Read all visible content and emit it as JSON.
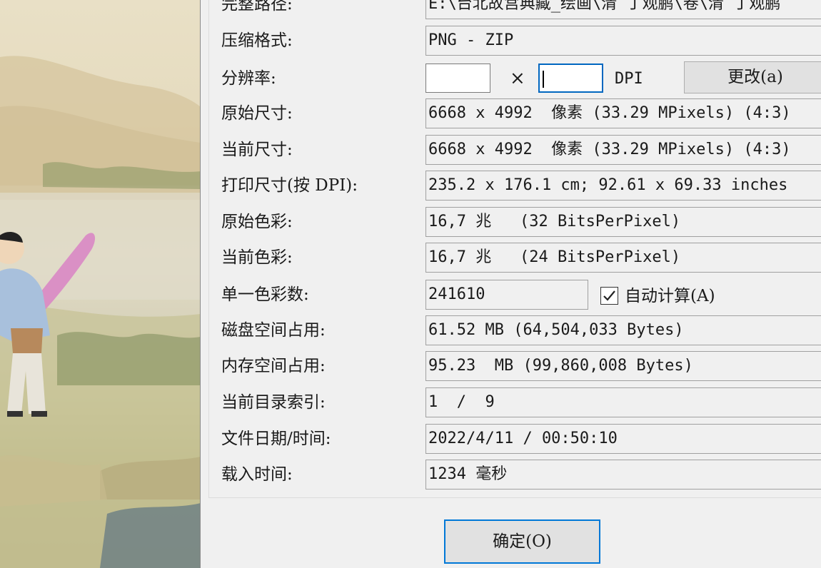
{
  "rows": {
    "full_path": {
      "label": "完整路径:",
      "value": "E:\\台北故宫典藏_绘画\\清 丁观鹏\\卷\\清 丁观鹏"
    },
    "compression": {
      "label": "压缩格式:",
      "value": "PNG - ZIP"
    },
    "resolution": {
      "label": "分辨率:",
      "times": "×",
      "unit": "DPI",
      "x_value": "",
      "y_value": "",
      "change_button": "更改(a)"
    },
    "original_size": {
      "label": "原始尺寸:",
      "value": "6668 x 4992  像素 (33.29 MPixels) (4:3)"
    },
    "current_size": {
      "label": "当前尺寸:",
      "value": "6668 x 4992  像素 (33.29 MPixels) (4:3)"
    },
    "print_size": {
      "label": "打印尺寸(按 DPI):",
      "value": "235.2 x 176.1 cm; 92.61 x 69.33 inches"
    },
    "original_colors": {
      "label": "原始色彩:",
      "value": "16,7 兆   (32 BitsPerPixel)"
    },
    "current_colors": {
      "label": "当前色彩:",
      "value": "16,7 兆   (24 BitsPerPixel)"
    },
    "unique_colors": {
      "label": "单一色彩数:",
      "value": "241610",
      "auto_label": "自动计算(A)",
      "auto_checked": true
    },
    "disk_size": {
      "label": "磁盘空间占用:",
      "value": "61.52 MB (64,504,033 Bytes)"
    },
    "memory_size": {
      "label": "内存空间占用:",
      "value": "95.23  MB (99,860,008 Bytes)"
    },
    "dir_index": {
      "label": "当前目录索引:",
      "value": "1  /  9"
    },
    "file_date": {
      "label": "文件日期/时间:",
      "value": "2022/4/11 / 00:50:10"
    },
    "load_time": {
      "label": "载入时间:",
      "value": "1234 毫秒"
    }
  },
  "ok_button": "确定(O)",
  "icons": {
    "checkbox": "checkmark-icon"
  },
  "colors": {
    "accent": "#0078d7",
    "focus": "#0067c0"
  }
}
